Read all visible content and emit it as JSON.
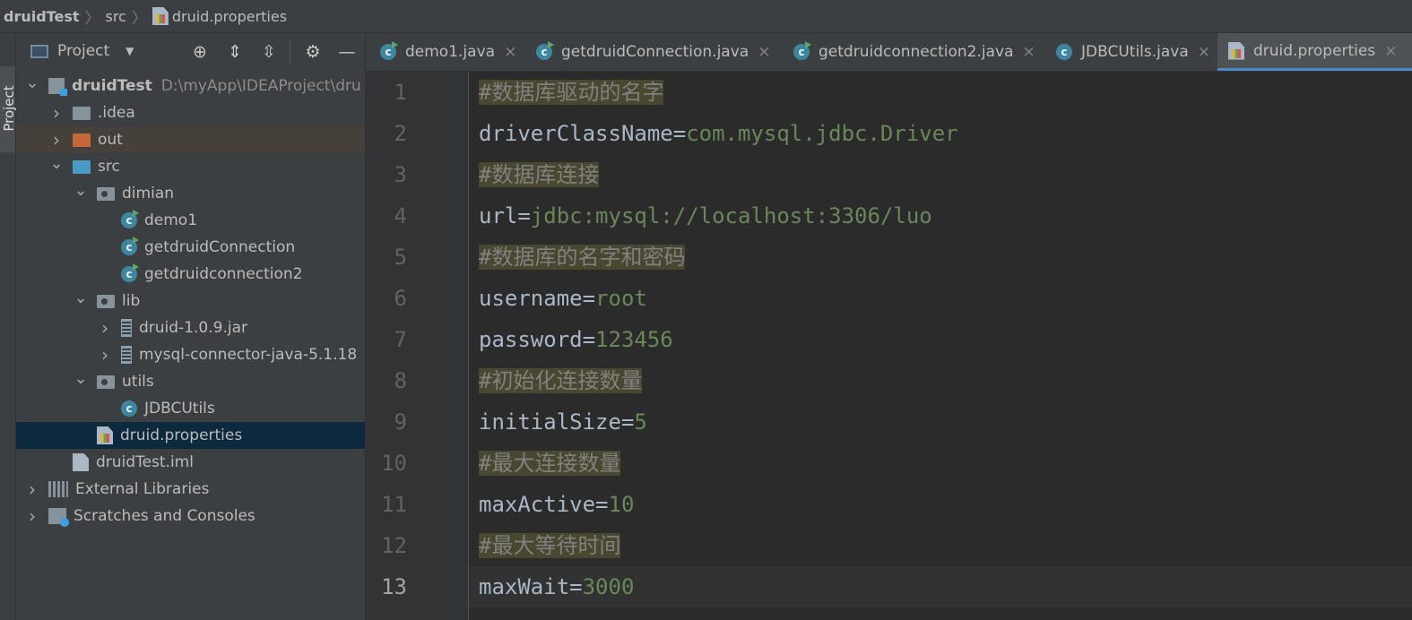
{
  "breadcrumb": [
    "druidTest",
    "src",
    "druid.properties"
  ],
  "tool_strip": {
    "project_tab": "Project"
  },
  "project_panel": {
    "title": "Project",
    "tree": [
      {
        "label": "druidTest",
        "extra": "D:\\myApp\\IDEAProject\\dru",
        "icon": "project-folder-icon",
        "level": 0,
        "expanded": true
      },
      {
        "label": ".idea",
        "icon": "folder-icon",
        "level": 1,
        "expanded": false
      },
      {
        "label": "out",
        "icon": "excluded-folder-icon",
        "level": 1,
        "expanded": false
      },
      {
        "label": "src",
        "icon": "source-folder-icon",
        "level": 1,
        "expanded": true
      },
      {
        "label": "dimian",
        "icon": "package-icon",
        "level": 2,
        "expanded": true
      },
      {
        "label": "demo1",
        "icon": "class-run-icon",
        "level": 3
      },
      {
        "label": "getdruidConnection",
        "icon": "class-run-icon",
        "level": 3
      },
      {
        "label": "getdruidconnection2",
        "icon": "class-run-icon",
        "level": 3
      },
      {
        "label": "lib",
        "icon": "package-icon",
        "level": 2,
        "expanded": true
      },
      {
        "label": "druid-1.0.9.jar",
        "icon": "jar-icon",
        "level": 3,
        "expanded": false
      },
      {
        "label": "mysql-connector-java-5.1.18",
        "icon": "jar-icon",
        "level": 3,
        "expanded": false
      },
      {
        "label": "utils",
        "icon": "package-icon",
        "level": 2,
        "expanded": true
      },
      {
        "label": "JDBCUtils",
        "icon": "class-icon",
        "level": 3
      },
      {
        "label": "druid.properties",
        "icon": "properties-file-icon",
        "level": 2,
        "selected": true
      },
      {
        "label": "druidTest.iml",
        "icon": "iml-file-icon",
        "level": 1
      },
      {
        "label": "External Libraries",
        "icon": "libraries-icon",
        "level": 0,
        "expanded": false
      },
      {
        "label": "Scratches and Consoles",
        "icon": "scratches-icon",
        "level": 0,
        "expanded": false
      }
    ]
  },
  "tabs": [
    {
      "label": "demo1.java",
      "icon": "class-run-icon",
      "active": false
    },
    {
      "label": "getdruidConnection.java",
      "icon": "class-run-icon",
      "active": false
    },
    {
      "label": "getdruidconnection2.java",
      "icon": "class-run-icon",
      "active": false
    },
    {
      "label": "JDBCUtils.java",
      "icon": "class-icon",
      "active": false
    },
    {
      "label": "druid.properties",
      "icon": "properties-file-icon",
      "active": true
    }
  ],
  "tab_close_glyph": "×",
  "editor": {
    "current_line": 13,
    "lines": [
      {
        "n": "1",
        "comment": "#数据库驱动的名字"
      },
      {
        "n": "2",
        "key": "driverClassName=",
        "value": "com.mysql.jdbc.Driver"
      },
      {
        "n": "3",
        "comment": "#数据库连接"
      },
      {
        "n": "4",
        "key": "url=",
        "value": "jdbc:mysql://localhost:3306/luo"
      },
      {
        "n": "5",
        "comment": "#数据库的名字和密码"
      },
      {
        "n": "6",
        "key": "username=",
        "value": "root"
      },
      {
        "n": "7",
        "key": "password=",
        "value": "123456"
      },
      {
        "n": "8",
        "comment": "#初始化连接数量"
      },
      {
        "n": "9",
        "key": "initialSize=",
        "value": "5"
      },
      {
        "n": "10",
        "comment": "#最大连接数量"
      },
      {
        "n": "11",
        "key": "maxActive=",
        "value": "10"
      },
      {
        "n": "12",
        "comment": "#最大等待时间"
      },
      {
        "n": "13",
        "key": "maxWait=",
        "value": "3000"
      }
    ]
  },
  "colors": {
    "comment_bg": "#49472f",
    "value_green": "#6a8759",
    "selection": "#0d293e",
    "accent_tab": "#4a88c7"
  }
}
